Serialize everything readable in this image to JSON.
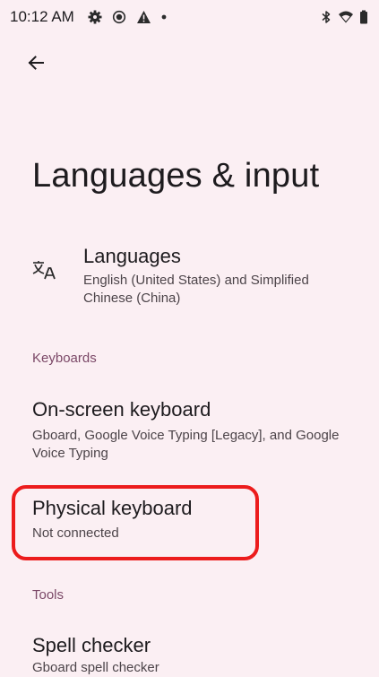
{
  "status_bar": {
    "time": "10:12 AM",
    "left_icons": [
      "settings-gear-icon",
      "record-icon",
      "alert-icon",
      "dot-icon"
    ],
    "right_icons": [
      "bluetooth-icon",
      "wifi-icon",
      "battery-icon"
    ]
  },
  "header": {
    "back_icon": "arrow-left-icon",
    "title": "Languages & input"
  },
  "items": {
    "languages": {
      "title": "Languages",
      "summary": "English (United States) and Simplified Chinese (China)",
      "icon": "translate-icon"
    },
    "keyboards_category": "Keyboards",
    "onscreen_keyboard": {
      "title": "On-screen keyboard",
      "summary": "Gboard, Google Voice Typing [Legacy], and Google Voice Typing"
    },
    "physical_keyboard": {
      "title": "Physical keyboard",
      "summary": "Not connected"
    },
    "tools_category": "Tools",
    "spell_checker": {
      "title": "Spell checker",
      "summary": "Gboard spell checker"
    }
  },
  "colors": {
    "background": "#fbeff3",
    "category_text": "#7b4867",
    "highlight": "#ec1c1c"
  }
}
